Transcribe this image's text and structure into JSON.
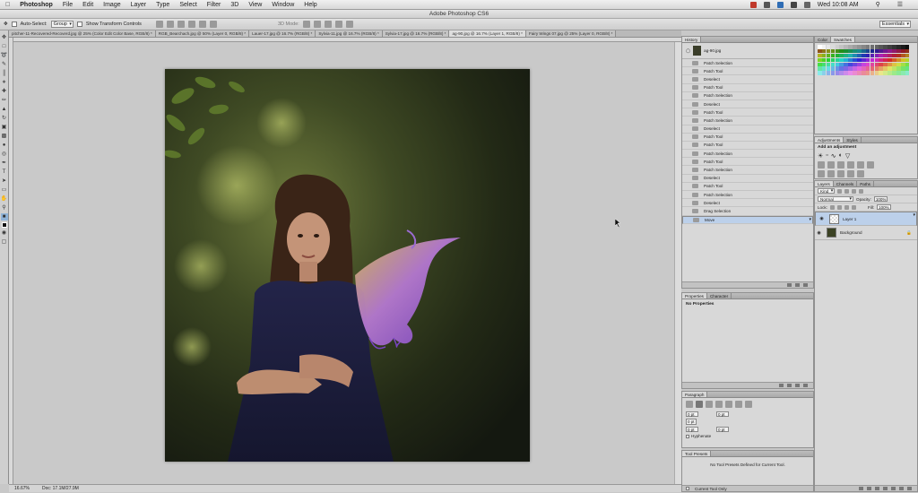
{
  "menubar": {
    "app": "Photoshop",
    "items": [
      "File",
      "Edit",
      "Image",
      "Layer",
      "Type",
      "Select",
      "Filter",
      "3D",
      "View",
      "Window",
      "Help"
    ],
    "clock": "Wed 10:08 AM"
  },
  "window_title": "Adobe Photoshop CS6",
  "options": {
    "auto_select": "Auto-Select:",
    "auto_select_value": "Group",
    "show_transform": "Show Transform Controls",
    "mode_3d": "3D Mode:",
    "workspace": "Essentials"
  },
  "tabs": [
    {
      "label": "pitcher-11-Recovered-Recoverd.jpg @ 25% (Color Edit Color Base, RGB/8) *",
      "active": false
    },
    {
      "label": "RGB_Bearchach.jpg @ 50% (Layer 0, RGB/8) *",
      "active": false
    },
    {
      "label": "Lauer-17.jpg @ 16.7% (RGB/8) *",
      "active": false
    },
    {
      "label": "Sylvia-11.jpg @ 16.7% (RGB/8) *",
      "active": false
    },
    {
      "label": "Sylvia-17.jpg @ 16.7% (RGB/8) *",
      "active": false
    },
    {
      "label": "ag-90.jpg @ 16.7% (Layer 1, RGB/8) *",
      "active": true
    },
    {
      "label": "Fairy Wings 07.jpg @ 25% (Layer 0, RGB/8) *",
      "active": false
    }
  ],
  "status": {
    "zoom": "16.67%",
    "doc": "Doc: 17.1M/27.9M"
  },
  "history": {
    "header": "History",
    "snapshot": "ag-90.jpg",
    "items": [
      "Patch Selection",
      "Patch Tool",
      "Deselect",
      "Patch Tool",
      "Patch Selection",
      "Deselect",
      "Patch Tool",
      "Patch Selection",
      "Deselect",
      "Patch Tool",
      "Patch Tool",
      "Patch Selection",
      "Patch Tool",
      "Patch Selection",
      "Deselect",
      "Patch Tool",
      "Patch Selection",
      "Deselect",
      "Drag Selection",
      "Move"
    ],
    "selected_index": 19
  },
  "properties": {
    "tabs": [
      "Properties",
      "Character"
    ],
    "empty": "No Properties"
  },
  "paragraph": {
    "header": "Paragraph",
    "indent": "0 pt",
    "hyphenate": "Hyphenate"
  },
  "tool_presets": {
    "header": "Tool Presets",
    "empty": "No Tool Presets Defined for Current Tool.",
    "current_only": "Current Tool Only"
  },
  "swatches": {
    "tabs": [
      "Color",
      "Swatches"
    ]
  },
  "adjustments": {
    "tabs": [
      "Adjustments",
      "Styles"
    ],
    "add": "Add an adjustment"
  },
  "layers": {
    "tabs": [
      "Layers",
      "Channels",
      "Paths"
    ],
    "kind": "Kind",
    "blend": "Normal",
    "opacity_label": "Opacity:",
    "opacity": "100%",
    "lock_label": "Lock:",
    "fill_label": "Fill:",
    "fill": "100%",
    "items": [
      {
        "name": "Layer 1",
        "selected": true
      },
      {
        "name": "Background",
        "selected": false
      }
    ]
  },
  "colors": {
    "menubar": "#e6e6e6",
    "selection": "#bcd0ea",
    "active_tool": "#8fb3d8"
  }
}
